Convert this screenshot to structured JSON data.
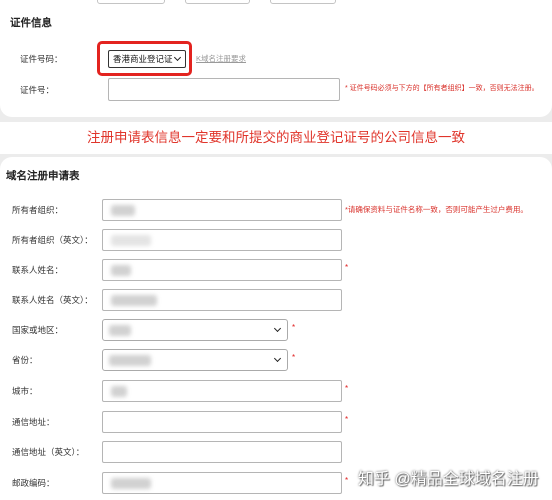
{
  "cert_section": {
    "title": "证件信息",
    "id_type_label": "证件号码：",
    "id_type_value": "香港商业登记证",
    "requirements_link": "K域名注册要求",
    "id_number_label": "证件号：",
    "id_number_note": "* 证件号码必须与下方的【所有者组织】一致，否则无法注册。"
  },
  "banner": {
    "text": "注册申请表信息一定要和所提交的商业登记证号的公司信息一致"
  },
  "form": {
    "title": "域名注册申请表",
    "required_mark": "*",
    "fields": [
      {
        "label": "所有者组织：",
        "type": "input",
        "note": "*请确保资料与证件名称一致，否则可能产生过户费用。"
      },
      {
        "label": "所有者组织（英文）：",
        "type": "input"
      },
      {
        "label": "联系人姓名：",
        "type": "input",
        "required": true
      },
      {
        "label": "联系人姓名（英文）：",
        "type": "input"
      },
      {
        "label": "国家或地区：",
        "type": "select",
        "required": true
      },
      {
        "label": "省份：",
        "type": "select",
        "required": true
      },
      {
        "label": "城市：",
        "type": "input",
        "required": true
      },
      {
        "label": "通信地址：",
        "type": "input",
        "required": true
      },
      {
        "label": "通信地址（英文）：",
        "type": "input"
      },
      {
        "label": "邮政编码：",
        "type": "input",
        "required": true
      }
    ]
  },
  "watermark": "知乎 @精品全球域名注册",
  "colors": {
    "highlight_red": "#e3231f",
    "banner_red": "#e0352b",
    "note_red": "#d9302a",
    "page_background": "#ececec"
  }
}
